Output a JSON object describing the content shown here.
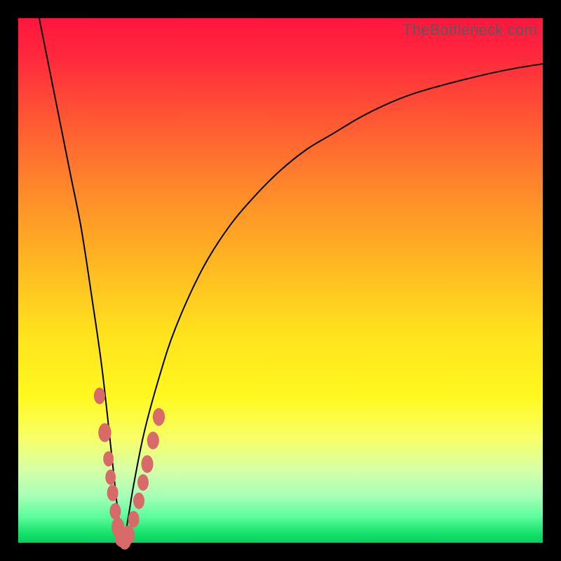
{
  "watermark": "TheBottleneck.com",
  "colors": {
    "frame": "#000000",
    "curve": "#000000",
    "bead": "#d86a6a",
    "gradient_stops": [
      "#ff153f",
      "#ff2b3d",
      "#ff5a33",
      "#ff8a2a",
      "#ffb822",
      "#ffe21e",
      "#fff81f",
      "#f8ff66",
      "#d7ffa6",
      "#a7ffb8",
      "#5dfd9d",
      "#19e36e",
      "#08ce5d"
    ]
  },
  "chart_data": {
    "type": "line",
    "title": "",
    "xlabel": "",
    "ylabel": "",
    "x_range": [
      0,
      100
    ],
    "y_range": [
      0,
      100
    ],
    "minimum_x": 20,
    "series": [
      {
        "name": "bottleneck-curve",
        "x": [
          4,
          6,
          8,
          10,
          12,
          14,
          16,
          18,
          19,
          20,
          21,
          22,
          24,
          27,
          30,
          35,
          40,
          45,
          50,
          55,
          60,
          65,
          70,
          75,
          80,
          85,
          90,
          95,
          100
        ],
        "y": [
          100,
          90,
          80,
          70,
          60,
          47,
          33,
          15,
          6,
          0,
          5,
          11,
          21,
          32,
          41,
          52,
          60,
          66,
          71,
          75,
          78,
          81,
          83.5,
          85.5,
          87,
          88.3,
          89.5,
          90.5,
          91.3
        ]
      }
    ],
    "bead_cluster": {
      "description": "highlighted points near curve minimum",
      "points": [
        {
          "x": 15.5,
          "y": 28,
          "r": 1.4
        },
        {
          "x": 16.5,
          "y": 21,
          "r": 1.6
        },
        {
          "x": 17.2,
          "y": 16,
          "r": 1.3
        },
        {
          "x": 17.6,
          "y": 12.5,
          "r": 1.3
        },
        {
          "x": 18.0,
          "y": 9.5,
          "r": 1.4
        },
        {
          "x": 18.5,
          "y": 6.0,
          "r": 1.4
        },
        {
          "x": 19.0,
          "y": 3.0,
          "r": 1.6
        },
        {
          "x": 19.6,
          "y": 1.0,
          "r": 1.6
        },
        {
          "x": 20.3,
          "y": 0.5,
          "r": 1.6
        },
        {
          "x": 21.0,
          "y": 1.5,
          "r": 1.6
        },
        {
          "x": 22.0,
          "y": 4.5,
          "r": 1.4
        },
        {
          "x": 23.0,
          "y": 8.0,
          "r": 1.4
        },
        {
          "x": 23.8,
          "y": 11.5,
          "r": 1.4
        },
        {
          "x": 24.6,
          "y": 15.0,
          "r": 1.5
        },
        {
          "x": 25.7,
          "y": 19.5,
          "r": 1.5
        },
        {
          "x": 26.8,
          "y": 24.0,
          "r": 1.5
        }
      ]
    }
  }
}
